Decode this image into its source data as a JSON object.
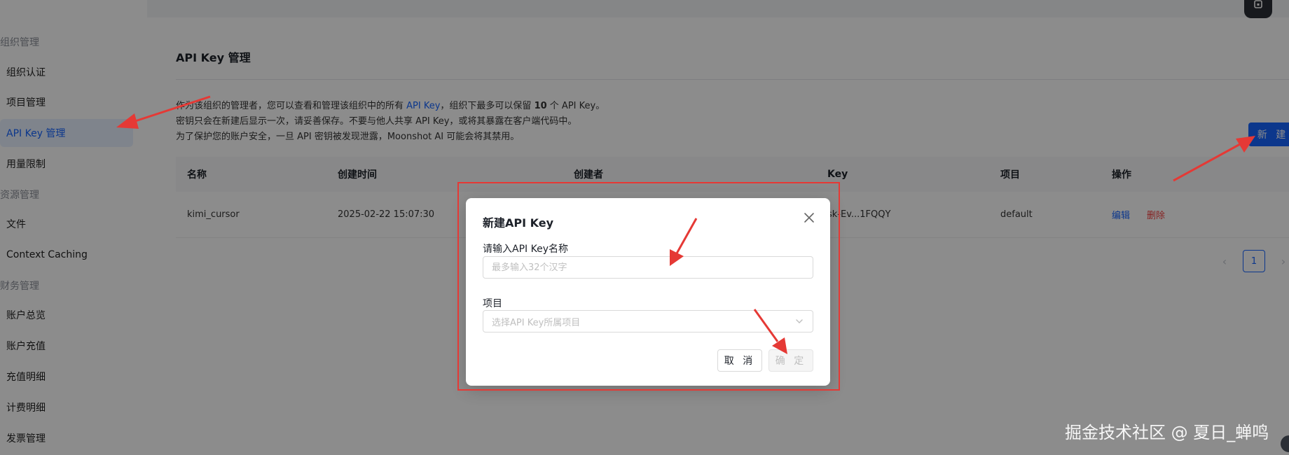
{
  "sidebar": {
    "groups": [
      {
        "title": "组织管理",
        "items": [
          "组织认证",
          "项目管理",
          "API Key 管理",
          "用量限制"
        ]
      },
      {
        "title": "资源管理",
        "items": [
          "文件",
          "Context Caching"
        ]
      },
      {
        "title": "财务管理",
        "items": [
          "账户总览",
          "账户充值",
          "充值明细",
          "计费明细",
          "发票管理"
        ]
      }
    ],
    "active_item": "API Key 管理"
  },
  "main": {
    "title": "API Key 管理",
    "notice": {
      "line1_a": "作为该组织的管理者，您可以查看和管理该组织中的所有 ",
      "line1_b": "API Key",
      "line1_c": "，组织下最多可以保留 ",
      "line1_d": "10",
      "line1_e": " 个 API Key。",
      "line2": "密钥只会在新建后显示一次，请妥善保存。不要与他人共享 API Key，或将其暴露在客户端代码中。",
      "line3": "为了保护您的账户安全，一旦 API 密钥被发现泄露，Moonshot AI 可能会将其禁用。"
    },
    "new_button": "新 建",
    "table": {
      "columns": [
        "名称",
        "创建时间",
        "创建者",
        "Key",
        "项目",
        "操作"
      ],
      "rows": [
        {
          "name": "kimi_cursor",
          "created": "2025-02-22 15:07:30",
          "creator": "",
          "key": "sk-Ev...1FQQY",
          "project": "default",
          "edit": "编辑",
          "delete": "删除"
        }
      ]
    },
    "pagination": {
      "current": "1",
      "prev": "‹",
      "next": "›"
    }
  },
  "modal": {
    "title": "新建API Key",
    "name_label": "请输入API Key名称",
    "name_placeholder": "最多输入32个汉字",
    "project_label": "项目",
    "project_placeholder": "选择API Key所属项目",
    "cancel": "取 消",
    "confirm": "确 定"
  },
  "watermark": "掘金技术社区 @ 夏日_蝉鸣",
  "colors": {
    "accent": "#1664ff",
    "danger": "#f53f3f",
    "annotation": "#e53935"
  }
}
